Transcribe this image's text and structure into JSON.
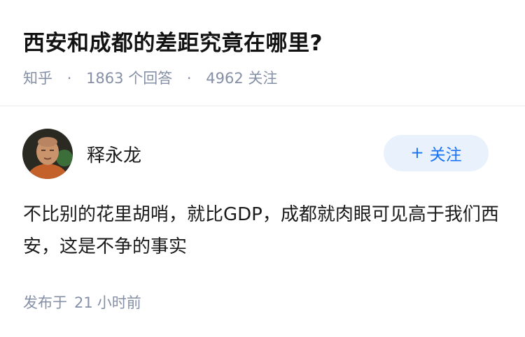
{
  "question": {
    "title": "西安和成都的差距究竟在哪里?",
    "source": "知乎",
    "answers_count": "1863",
    "answers_label": "个回答",
    "followers_count": "4962",
    "followers_label": "关注"
  },
  "author": {
    "name": "释永龙",
    "avatar_icon": "avatar-photo",
    "follow_label": "关注",
    "follow_icon": "plus-icon"
  },
  "answer": {
    "text": "不比别的花里胡哨，就比GDP，成都就肉眼可见高于我们西安，这是不争的事实"
  },
  "footer": {
    "published_label": "发布于",
    "published_num": "21",
    "published_unit": "小时前"
  },
  "colors": {
    "meta_gray": "#8590a6",
    "follow_bg": "#e9f2fc",
    "follow_text": "#1772f6",
    "divider": "#ebebeb"
  }
}
